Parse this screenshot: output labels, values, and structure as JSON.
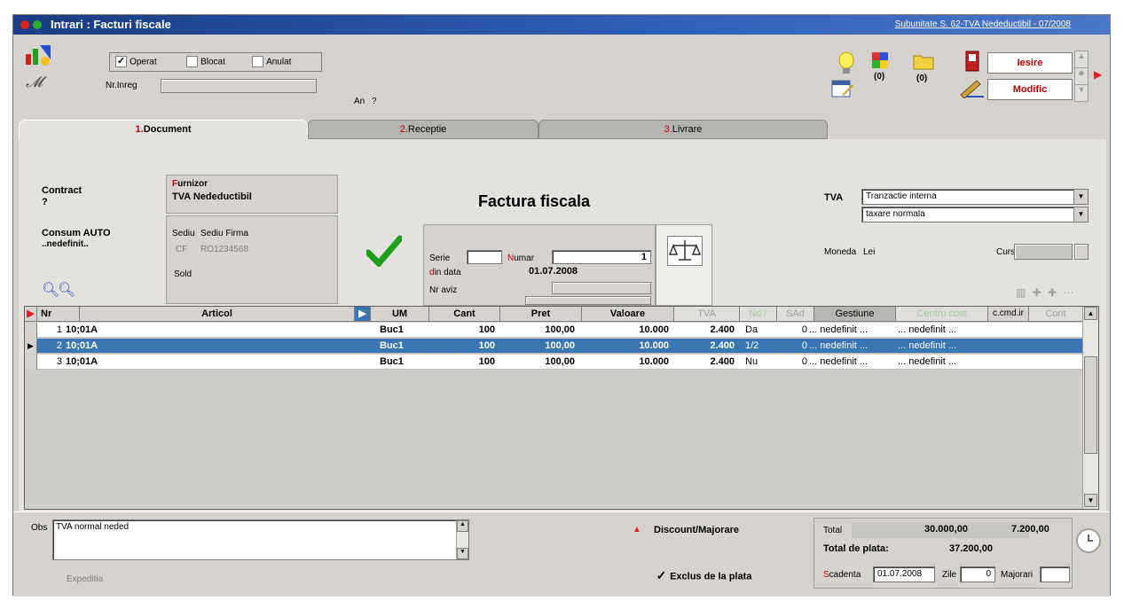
{
  "window": {
    "title": "Intrari : Facturi fiscale",
    "subunit": "Subunitate S. 62-TVA Nedeductibil - 07/2008"
  },
  "toolbar": {
    "operat_label": "Operat",
    "operat_checked": "✓",
    "blocat_label": "Blocat",
    "anulat_label": "Anulat",
    "nrinreg_label": "Nr.Inreg",
    "an_label": "An",
    "an_value": "?",
    "count1": "(0)",
    "count2": "(0)",
    "iesire_label": "Iesire",
    "modific_label": "Modific"
  },
  "tabs": [
    {
      "num": "1.",
      "label": "Document"
    },
    {
      "num": "2.",
      "label": "Receptie"
    },
    {
      "num": "3.",
      "label": "Livrare"
    }
  ],
  "document": {
    "contract_label": "Contract",
    "contract_value": "?",
    "consum_label": "Consum AUTO",
    "consum_value": "..nedefinit..",
    "furnizor_first": "F",
    "furnizor_rest": "urnizor",
    "furnizor_name": "TVA Nedeductibil",
    "sediu_label": "Sediu",
    "sediu_value": "Sediu Firma",
    "cf_label": "CF",
    "cf_value": "RO1234568",
    "sold_label": "Sold",
    "doc_title": "Factura fiscala",
    "serie_label": "Serie",
    "numar_first": "N",
    "numar_rest": "umar",
    "numar_value": "1",
    "dindata_first": "d",
    "dindata_rest": "in data",
    "dindata_value": "01.07.2008",
    "nraviz_label": "Nr aviz",
    "tva_label": "TVA",
    "tva_select1": "Tranzactie interna",
    "tva_select2": "taxare normala",
    "moneda_label": "Moneda",
    "moneda_value": "Lei",
    "curs_label": "Curs"
  },
  "grid": {
    "headers": {
      "nr": "Nr",
      "articol": "Articol",
      "um": "UM",
      "cant": "Cant",
      "pret": "Pret",
      "valoare": "Valoare",
      "tva": "TVA",
      "nd": "Nd?",
      "sad": "SAd",
      "gestiune": "Gestiune",
      "centru": "Centru cost",
      "comanda": "c.cmd.ir",
      "cont": "Cont"
    },
    "rows": [
      {
        "nr": "1",
        "articol": "10;01A",
        "um": "Buc1",
        "cant": "100",
        "pret": "100,00",
        "valoare": "10.000",
        "tva": "2.400",
        "nd": "Da",
        "sad": "0",
        "gestiune": "... nedefinit ...",
        "centru": "... nedefinit ..."
      },
      {
        "nr": "2",
        "articol": "10;01A",
        "um": "Buc1",
        "cant": "100",
        "pret": "100,00",
        "valoare": "10.000",
        "tva": "2.400",
        "nd": "1/2",
        "sad": "0",
        "gestiune": "... nedefinit ...",
        "centru": "... nedefinit ..."
      },
      {
        "nr": "3",
        "articol": "10;01A",
        "um": "Buc1",
        "cant": "100",
        "pret": "100,00",
        "valoare": "10.000",
        "tva": "2.400",
        "nd": "Nu",
        "sad": "0",
        "gestiune": "... nedefinit ...",
        "centru": "... nedefinit ..."
      }
    ]
  },
  "footer": {
    "obs_label": "Obs",
    "obs_value": "TVA normal neded",
    "expeditia_label": "Expeditia",
    "discount_label": "Discount/Majorare",
    "exclus_label": "Exclus de la plata",
    "total_label": "Total",
    "total_value": "30.000,00",
    "total_tva": "7.200,00",
    "total_plata_label": "Total de plata:",
    "total_plata_value": "37.200,00",
    "scadenta_first": "S",
    "scadenta_rest": "cadenta",
    "scadenta_value": "01.07.2008",
    "zile_label": "Zile",
    "zile_value": "0",
    "majorari_label": "Majorari"
  }
}
